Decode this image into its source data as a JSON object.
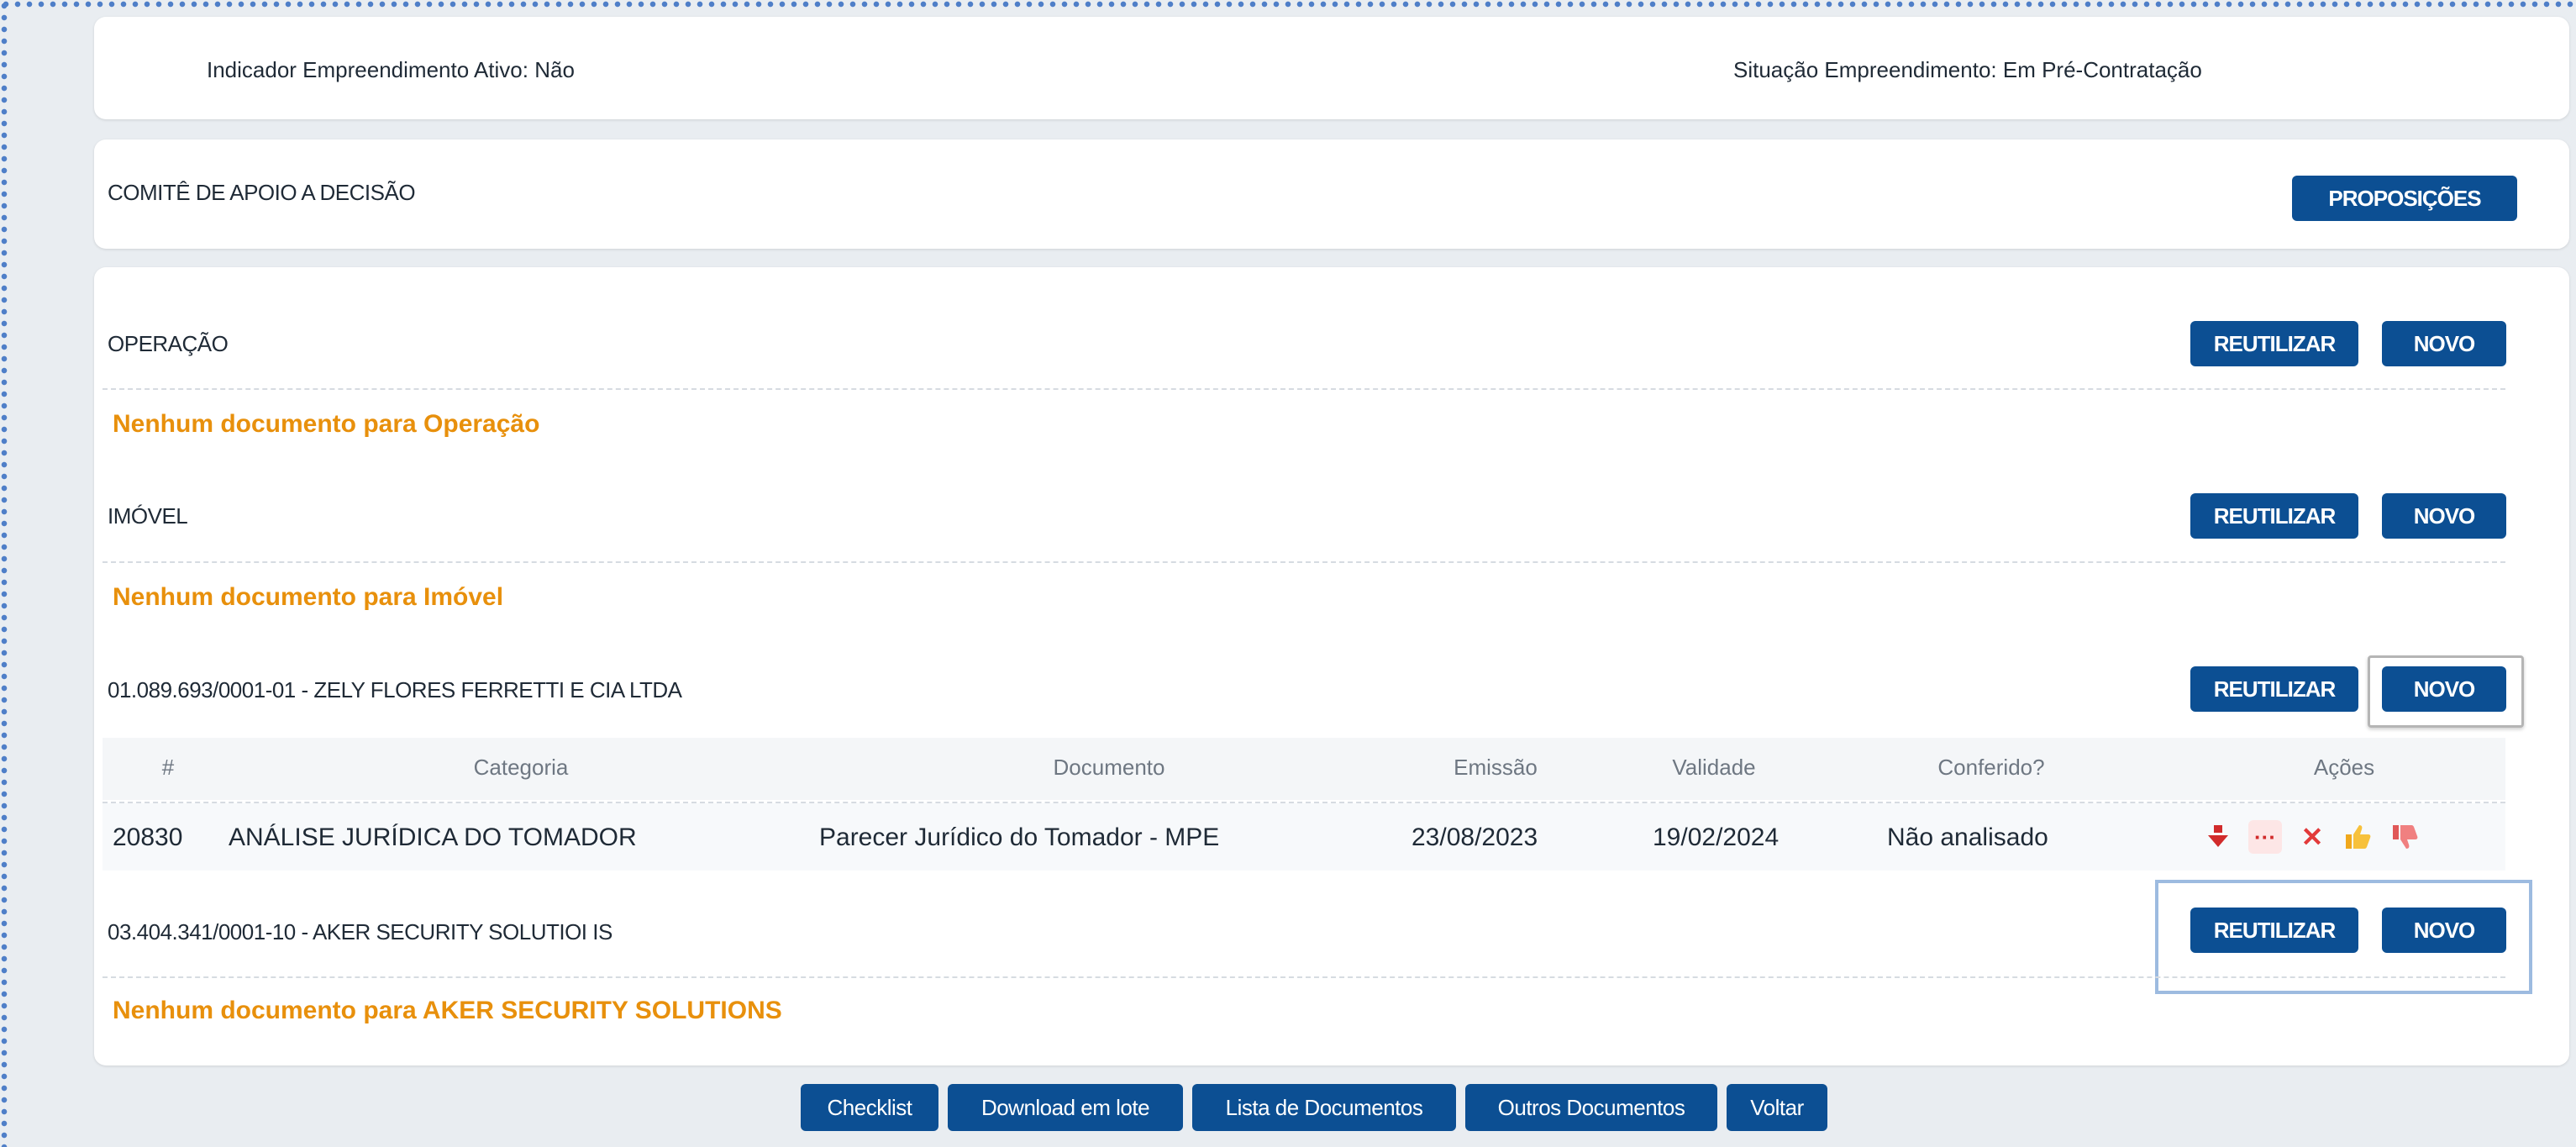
{
  "info": {
    "indicador_ativo": "Indicador Empreendimento Ativo: Não",
    "situacao": "Situação Empreendimento: Em Pré-Contratação"
  },
  "comite": {
    "title": "COMITÊ DE APOIO A DECISÃO",
    "button": "PROPOSIÇÕES"
  },
  "sections": {
    "operacao": {
      "title": "OPERAÇÃO",
      "empty": "Nenhum documento para Operação"
    },
    "imovel": {
      "title": "IMÓVEL",
      "empty": "Nenhum documento para Imóvel"
    },
    "zely": {
      "title": "01.089.693/0001-01 - ZELY FLORES FERRETTI E CIA LTDA"
    },
    "aker": {
      "title": "03.404.341/0001-10 - AKER SECURITY SOLUTIOI IS",
      "empty": "Nenhum documento para AKER SECURITY SOLUTIONS"
    }
  },
  "buttons": {
    "reutilizar": "REUTILIZAR",
    "novo": "NOVO"
  },
  "table": {
    "headers": [
      "#",
      "Categoria",
      "Documento",
      "Emissão",
      "Validade",
      "Conferido?",
      "Ações"
    ],
    "rows": [
      {
        "id": "20830",
        "categoria": "ANÁLISE JURÍDICA DO TOMADOR",
        "documento": "Parecer Jurídico do Tomador - MPE",
        "emissao": "23/08/2023",
        "validade": "19/02/2024",
        "conferido": "Não analisado",
        "acoes": [
          "download-icon",
          "more-options-icon",
          "delete-icon",
          "thumbs-up-icon",
          "thumbs-down-icon"
        ]
      }
    ]
  },
  "footer": {
    "checklist": "Checklist",
    "download_lote": "Download em lote",
    "lista_documentos": "Lista de Documentos",
    "outros_documentos": "Outros Documentos",
    "voltar": "Voltar"
  },
  "colors": {
    "primary": "#0c4f93",
    "warning_text": "#e8900c",
    "highlight_border": "#9dbbe0",
    "focus_border": "#b5b5b5"
  }
}
